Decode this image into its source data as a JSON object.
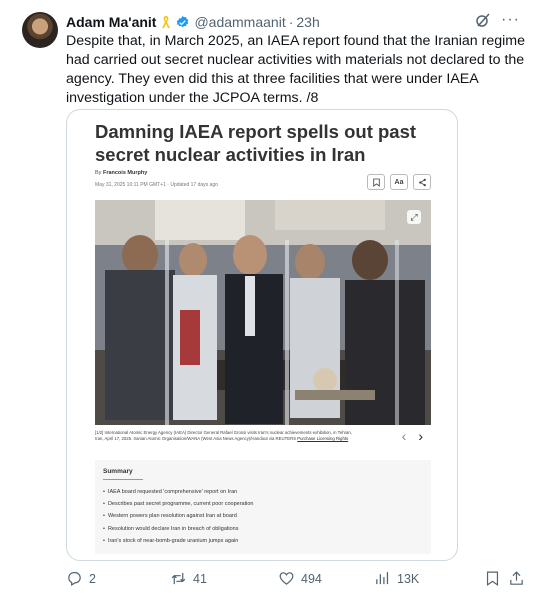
{
  "tweet": {
    "author_name": "Adam Ma'anit",
    "handle": "@adammaanit",
    "separator": "·",
    "time": "23h",
    "text": "Despite that, in March 2025, an IAEA report found that the Iranian regime had carried out secret nuclear activities with materials not declared to the agency. They even did this at three facilities that were under IAEA investigation under the JCPOA terms. /8",
    "icons": {
      "ribbon": "yellow-ribbon-icon",
      "verified": "verified-badge-icon",
      "grok": "grok-icon",
      "more": "more-icon"
    },
    "colors": {
      "verified": "#1d9bf0",
      "ribbon": "#f5c518",
      "muted": "#536471"
    }
  },
  "article": {
    "title": "Damning IAEA report spells out past secret nuclear activities in Iran",
    "byline_prefix": "By",
    "author": "Francois Murphy",
    "dateline": "May 31, 2025 10:11 PM GMT+1 · Updated 17 days ago",
    "tools": {
      "bookmark": "bookmark-icon",
      "text_size": "Aa",
      "share": "share-icon"
    },
    "caption": "[1/2] International Atomic Energy Agency (IAEA) Director General Rafael Grossi visits Iran's nuclear achievements exhibition, in Tehran, Iran, April 17, 2025. Iranian Atomic Organisation/WANA (West Asia News Agency)/Handout via REUTERS",
    "caption_link": "Purchase Licensing Rights",
    "nav_prev": "‹",
    "nav_next": "›",
    "summary": {
      "title": "Summary",
      "items": [
        "IAEA board requested 'comprehensive' report on Iran",
        "Describes past secret programme, current poor cooperation",
        "Western powers plan resolution against Iran at board",
        "Resolution would declare Iran in breach of obligations",
        "Iran's stock of near-bomb-grade uranium jumps again"
      ]
    }
  },
  "actions": {
    "replies": "2",
    "retweets": "41",
    "likes": "494",
    "views": "13K",
    "icons": [
      "reply-icon",
      "retweet-icon",
      "like-icon",
      "views-icon",
      "bookmark-icon",
      "share-icon"
    ]
  }
}
